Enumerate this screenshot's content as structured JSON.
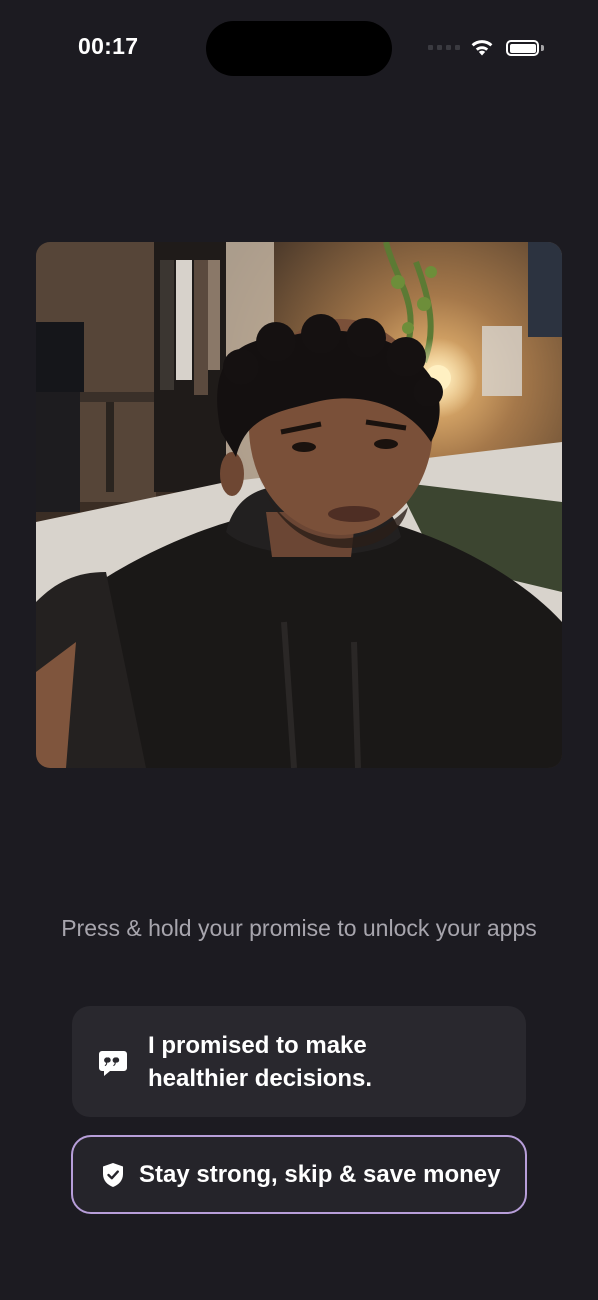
{
  "status_bar": {
    "time": "00:17"
  },
  "photo": {
    "icon": "selfie-photo"
  },
  "instruction": "Press & hold your promise to unlock your apps",
  "promise": {
    "icon": "quote-bubble-icon",
    "text": "I promised to make\nhealthier decisions."
  },
  "skip_button": {
    "icon": "shield-check-icon",
    "label": "Stay strong, skip & save money",
    "border_color": "#b79ed9"
  },
  "colors": {
    "background": "#1c1b21",
    "card": "#29282e",
    "instruction_text": "#a7a5ad"
  }
}
